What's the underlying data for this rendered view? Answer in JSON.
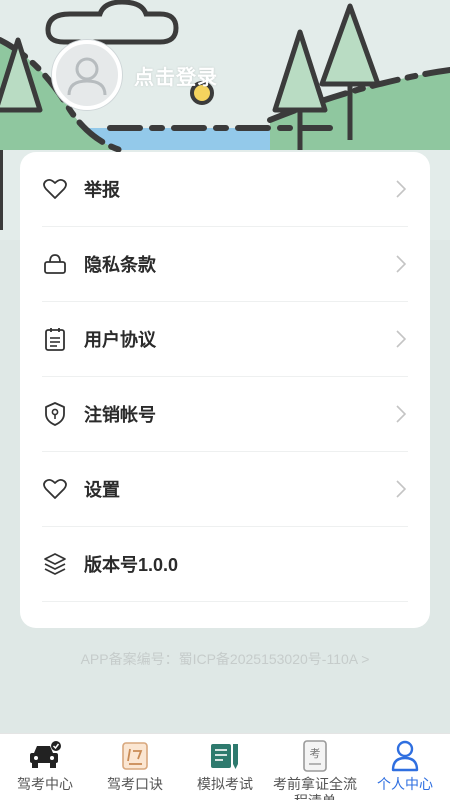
{
  "profile": {
    "login_label": "点击登录"
  },
  "menu": [
    {
      "label": "举报",
      "icon": "heart-icon",
      "chevron": true
    },
    {
      "label": "隐私条款",
      "icon": "lock-icon",
      "chevron": true
    },
    {
      "label": "用户协议",
      "icon": "notepad-icon",
      "chevron": true
    },
    {
      "label": "注销帐号",
      "icon": "shield-icon",
      "chevron": true
    },
    {
      "label": "设置",
      "icon": "heart-icon",
      "chevron": true
    },
    {
      "label": "版本号1.0.0",
      "icon": "layers-icon",
      "chevron": false
    }
  ],
  "icp": {
    "text": "APP备案编号：蜀ICP备2025153020号-110A  >"
  },
  "tabbar": [
    {
      "label": "驾考中心",
      "icon": "car-check-icon"
    },
    {
      "label": "驾考口诀",
      "icon": "formula-card-icon"
    },
    {
      "label": "模拟考试",
      "icon": "book-pen-icon"
    },
    {
      "label": "考前拿证全流程清单",
      "icon": "exam-doc-icon"
    },
    {
      "label": "个人中心",
      "icon": "person-icon",
      "active": true
    }
  ],
  "colors": {
    "accent": "#2f6fe0",
    "background": "#dfe8e6",
    "hill_green": "#8fc79f",
    "lake_blue": "#93c9ea"
  }
}
